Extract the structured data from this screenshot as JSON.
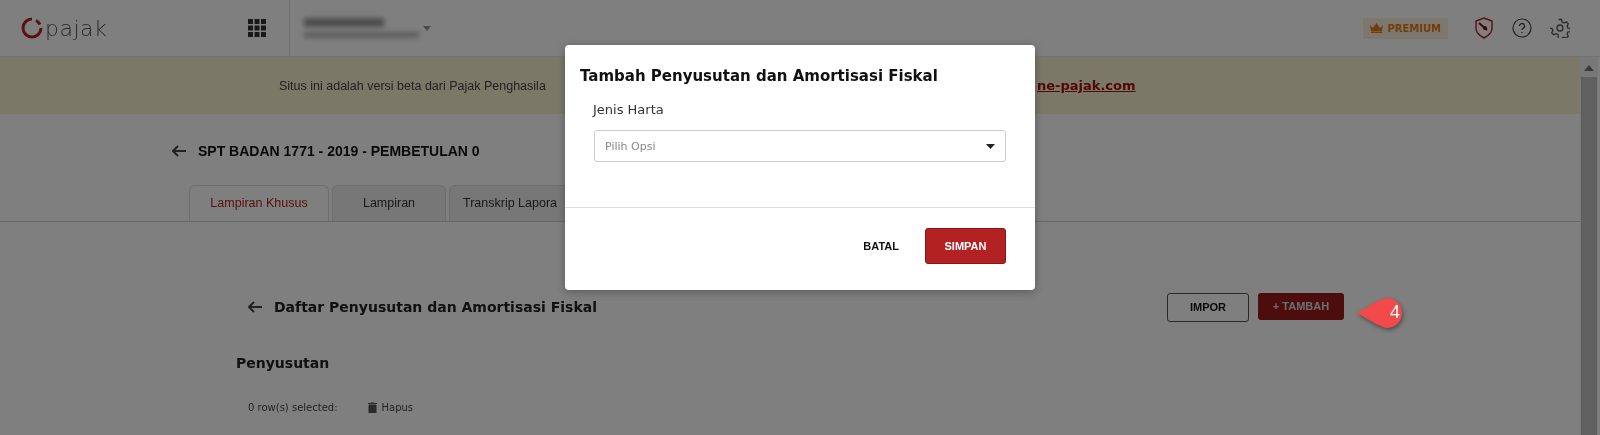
{
  "header": {
    "logo": "pajak",
    "premium_badge": "PREMIUM"
  },
  "banner": {
    "text": "Situs ini adalah versi beta dari Pajak Penghasila",
    "link": "ne-pajak.com"
  },
  "page_title": "SPT BADAN 1771 - 2019 - PEMBETULAN 0",
  "tabs": [
    {
      "label": "Lampiran Khusus",
      "selected": true
    },
    {
      "label": "Lampiran",
      "selected": false
    },
    {
      "label": "Transkrip Lapora",
      "selected": false
    }
  ],
  "section": {
    "title": "Daftar Penyusutan dan Amortisasi Fiskal",
    "buttons": [
      {
        "label": "IMPOR",
        "kind": "outline"
      },
      {
        "label": "+ TAMBAH",
        "kind": "primary"
      }
    ]
  },
  "subsection": {
    "title": "Penyusutan",
    "selection_count": "0 row(s) selected:",
    "delete_action": "Hapus"
  },
  "step_callout": "4",
  "dialog": {
    "title": "Tambah Penyusutan dan Amortisasi Fiskal",
    "field_label": "Jenis Harta",
    "select_placeholder": "Pilih Opsi",
    "buttons": [
      {
        "label": "BATAL",
        "kind": "text"
      },
      {
        "label": "SIMPAN",
        "kind": "primary"
      }
    ]
  }
}
